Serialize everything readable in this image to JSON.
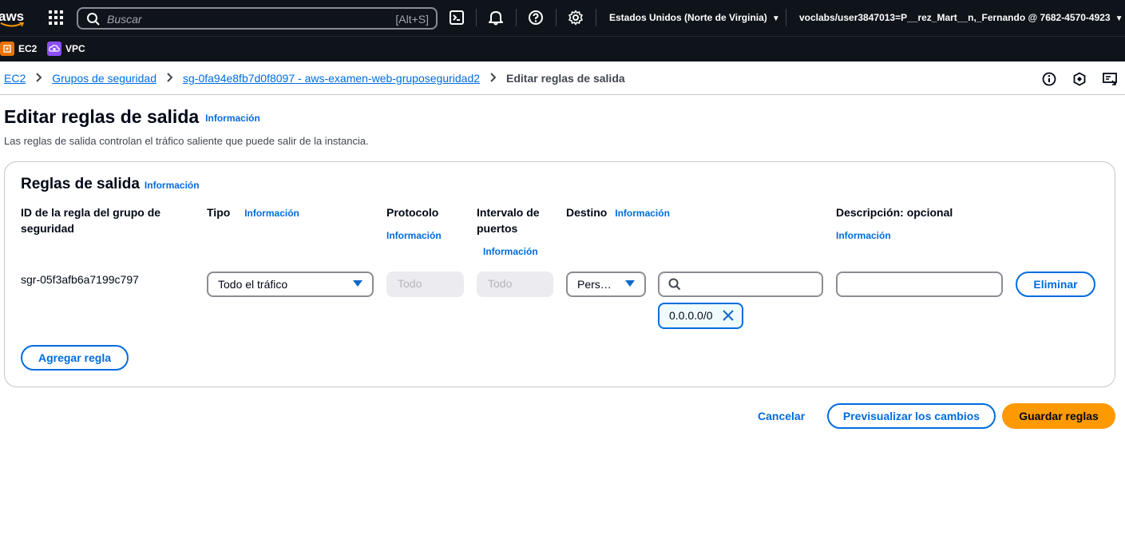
{
  "topnav": {
    "logo": "aws",
    "search_placeholder": "Buscar",
    "search_shortcut": "[Alt+S]",
    "region": "Estados Unidos (Norte de Virginia)",
    "account": "voclabs/user3847013=P__rez_Mart__n,_Fernando @ 7682-4570-4923",
    "icons": [
      "services-grid-icon",
      "cloudshell-icon",
      "notifications-icon",
      "help-icon",
      "settings-icon"
    ]
  },
  "favorites": [
    {
      "label": "EC2",
      "icon": "ec2-icon",
      "color": "#ed7100"
    },
    {
      "label": "VPC",
      "icon": "vpc-icon",
      "color": "#8c4fff"
    }
  ],
  "breadcrumb": {
    "items": [
      "EC2",
      "Grupos de seguridad",
      "sg-0fa94e8fb7d0f8097 - aws-examen-web-gruposeguridad2"
    ],
    "current": "Editar reglas de salida"
  },
  "page": {
    "title": "Editar reglas de salida",
    "info": "Información",
    "description": "Las reglas de salida controlan el tráfico saliente que puede salir de la instancia."
  },
  "panel": {
    "title": "Reglas de salida",
    "info": "Información",
    "columns": {
      "rule_id_line1": "ID de la regla del grupo de",
      "rule_id_line2": "seguridad",
      "type": "Tipo",
      "protocol": "Protocolo",
      "port_line1": "Intervalo de",
      "port_line2": "puertos",
      "destination": "Destino",
      "description": "Descripción: opcional",
      "info": "Información"
    },
    "rule": {
      "id": "sgr-05f3afb6a7199c797",
      "type": "Todo el tráfico",
      "protocol": "Todo",
      "port_range": "Todo",
      "destination_type": "Pers…",
      "destination_search": "",
      "destination_token": "0.0.0.0/0",
      "description": "",
      "delete_label": "Eliminar"
    },
    "add_rule_label": "Agregar regla"
  },
  "footer": {
    "cancel": "Cancelar",
    "preview": "Previsualizar los cambios",
    "save": "Guardar reglas"
  },
  "colors": {
    "nav_bg": "#0f141a",
    "link": "#006ce0",
    "primary": "#ff9900"
  }
}
